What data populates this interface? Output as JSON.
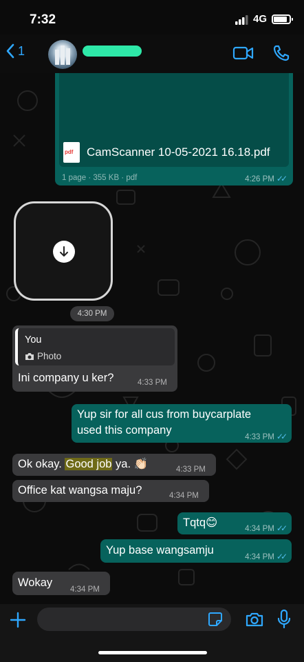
{
  "status": {
    "time": "7:32",
    "network": "4G"
  },
  "header": {
    "back_count": "1"
  },
  "messages": {
    "pdf": {
      "filename": "CamScanner 10-05-2021 16.18.pdf",
      "info": "1 page · 355 KB · pdf",
      "time": "4:26 PM",
      "icon_label": "pdf"
    },
    "sticker": {
      "time": "4:30 PM"
    },
    "reply": {
      "quote_author": "You",
      "quote_label": "Photo",
      "text": "Ini company u ker?",
      "time": "4:33 PM"
    },
    "out1": {
      "text_line1": "Yup sir for all cus from buycarplate",
      "text_line2": "used this company",
      "time": "4:33 PM"
    },
    "in2": {
      "text_before": "Ok okay.",
      "text_highlight": "Good job",
      "text_after": "ya. 👏🏻",
      "time": "4:33 PM"
    },
    "in3": {
      "text": "Office kat wangsa maju?",
      "time": "4:34 PM"
    },
    "out2": {
      "text": "Tqtq😊",
      "time": "4:34 PM"
    },
    "out3": {
      "text": "Yup base wangsamju",
      "time": "4:34 PM"
    },
    "in4": {
      "text": "Wokay",
      "time": "4:34 PM"
    }
  },
  "composer": {
    "placeholder": ""
  },
  "colors": {
    "outgoing": "#07625c",
    "incoming": "#3a3a3c",
    "accent": "#2fa8ff",
    "read_ticks": "#53bdeb"
  },
  "icons": [
    "back-chevron-icon",
    "video-call-icon",
    "phone-call-icon",
    "download-icon",
    "camera-icon",
    "plus-icon",
    "sticker-icon",
    "microphone-icon"
  ]
}
